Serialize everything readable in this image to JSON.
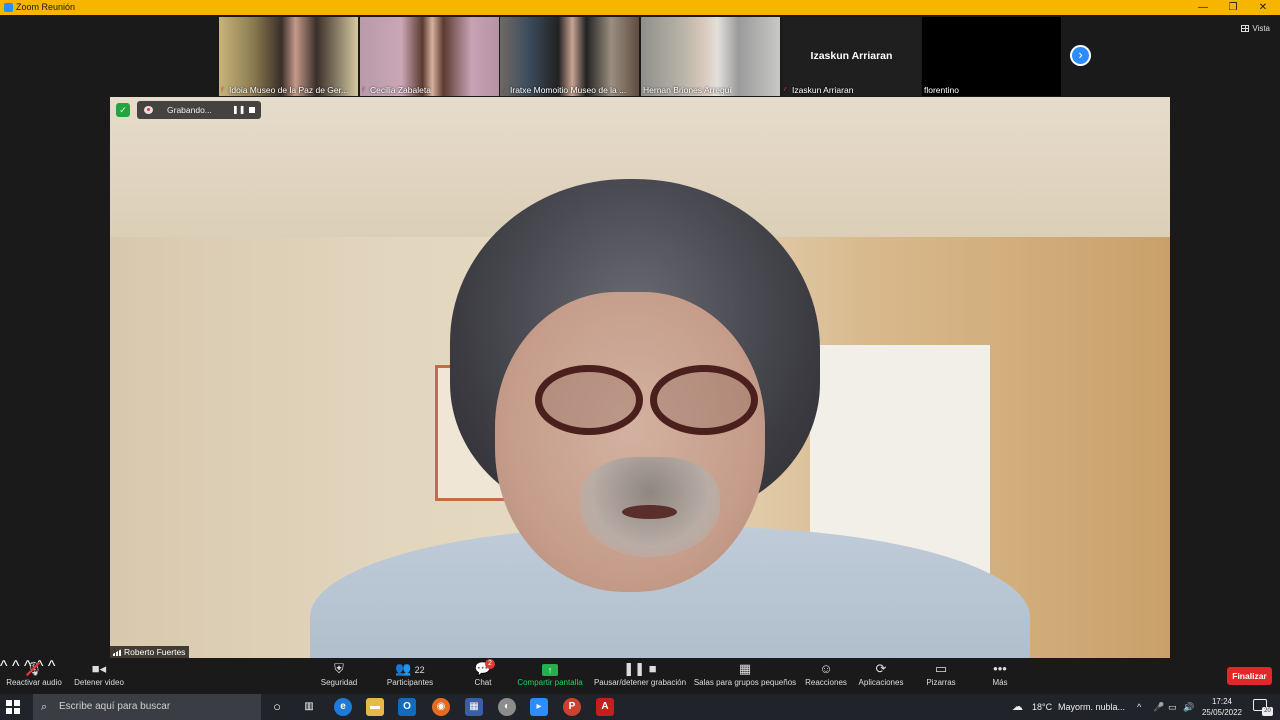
{
  "window": {
    "title": "Zoom Reunión",
    "controls": [
      "—",
      "❐",
      "✕"
    ]
  },
  "view_button": {
    "label": "Vista"
  },
  "participants_strip": [
    {
      "name": "Idoia Museo de la Paz de Ger...",
      "muted": true
    },
    {
      "name": "Cecilia Zabaleta",
      "muted": true
    },
    {
      "name": "Iratxe Momoitio Museo de la ...",
      "muted": true
    },
    {
      "name": "Hernan Briones Arregui",
      "muted": false
    },
    {
      "name": "Izaskun Arriaran",
      "center_name": "Izaskun Arriaran",
      "muted": true
    },
    {
      "name": "florentino",
      "muted": false
    }
  ],
  "next_page_icon": "chevron-right-icon",
  "recording": {
    "label": "Grabando...",
    "pause_icon": "❚❚"
  },
  "main_speaker": {
    "name": "Roberto Fuertes"
  },
  "toolbar": {
    "audio_label": "Reactivar audio",
    "video_label": "Detener video",
    "security_label": "Seguridad",
    "participants_label": "Participantes",
    "participants_count": "22",
    "chat_label": "Chat",
    "chat_badge": "2",
    "share_label": "Compartir pantalla",
    "record_label": "Pausar/detener grabación",
    "breakout_label": "Salas para grupos pequeños",
    "reactions_label": "Reacciones",
    "apps_label": "Aplicaciones",
    "whiteboards_label": "Pizarras",
    "more_label": "Más",
    "end_label": "Finalizar"
  },
  "taskbar": {
    "search_placeholder": "Escribe aquí para buscar",
    "weather_temp": "18°C",
    "weather_text": "Mayorm. nubla...",
    "time": "17:24",
    "date": "25/05/2022",
    "notification_count": "20"
  },
  "colors": {
    "titlebar": "#f7b500",
    "zoom_blue": "#2d8cff",
    "share_green": "#23b14d",
    "end_red": "#e02828"
  }
}
